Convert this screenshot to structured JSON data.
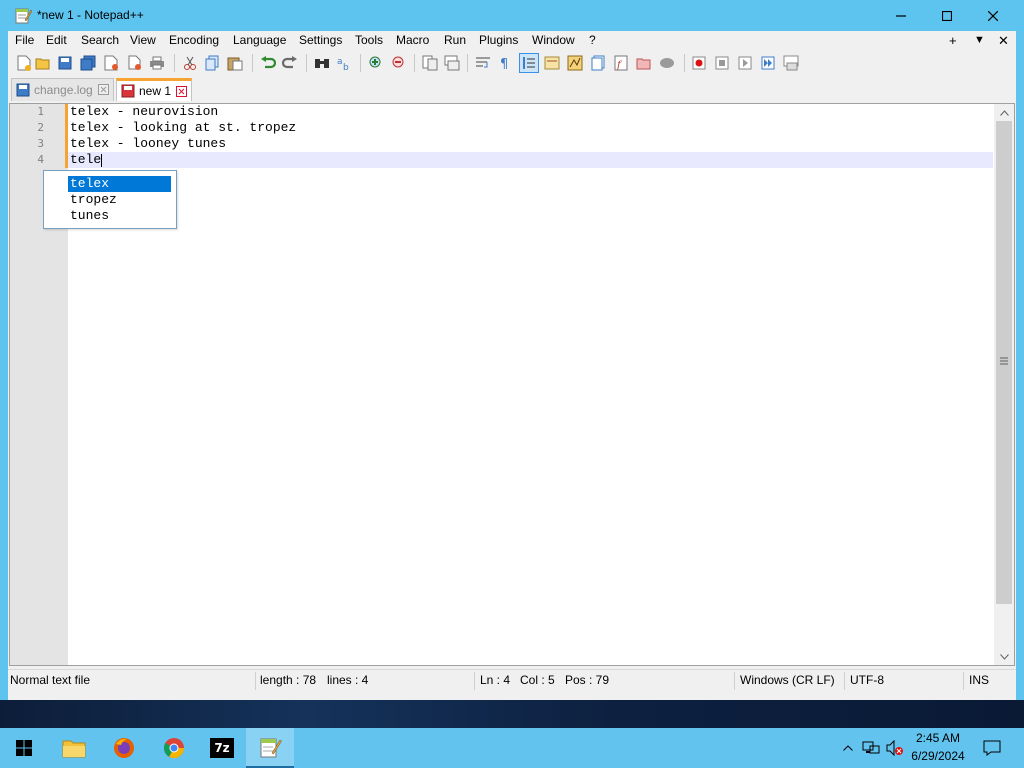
{
  "window": {
    "title": "*new 1 - Notepad++",
    "minimize_symbol": "—",
    "maximize_symbol": "☐",
    "close_symbol": "✕"
  },
  "menubar": {
    "items": [
      "File",
      "Edit",
      "Search",
      "View",
      "Encoding",
      "Language",
      "Settings",
      "Tools",
      "Macro",
      "Run",
      "Plugins",
      "Window",
      "?"
    ],
    "right_plus": "+",
    "right_dropdown": "▼",
    "right_close": "✕"
  },
  "toolbar": {
    "buttons": [
      "new-file-icon",
      "open-file-icon",
      "save-icon",
      "save-all-icon",
      "close-icon",
      "close-all-icon",
      "print-icon",
      "cut-icon",
      "copy-icon",
      "paste-icon",
      "undo-icon",
      "redo-icon",
      "find-icon",
      "replace-icon",
      "zoom-in-icon",
      "zoom-out-icon",
      "sync-vertical-icon",
      "sync-horizontal-icon",
      "word-wrap-icon",
      "show-all-chars-icon",
      "indent-guide-icon",
      "udl-icon",
      "document-map-icon",
      "document-list-icon",
      "function-list-icon",
      "folder-as-workspace-icon",
      "monitoring-icon",
      "record-macro-icon",
      "stop-record-icon",
      "play-macro-icon",
      "run-macro-multiple-icon",
      "save-macro-icon"
    ]
  },
  "tabs": [
    {
      "label": "change.log",
      "active": false
    },
    {
      "label": "new 1",
      "active": true
    }
  ],
  "editor": {
    "line_numbers": [
      "1",
      "2",
      "3",
      "4"
    ],
    "lines": [
      "telex - neurovision",
      "telex - looking at st. tropez",
      "telex - looney tunes",
      "tele"
    ],
    "autocomplete": {
      "items": [
        "telex",
        "tropez",
        "tunes"
      ],
      "selected_index": 0
    }
  },
  "statusbar": {
    "file_type": "Normal text file",
    "length": "length : 78",
    "lines": "lines : 4",
    "ln": "Ln : 4",
    "col": "Col : 5",
    "pos": "Pos : 79",
    "eol": "Windows (CR LF)",
    "encoding": "UTF-8",
    "mode": "INS"
  },
  "taskbar": {
    "apps": [
      "start-icon",
      "file-explorer-icon",
      "firefox-icon",
      "chrome-icon",
      "7zip-icon",
      "notepadpp-icon"
    ],
    "sevenzip_label": "7z",
    "clock_time": "2:45 AM",
    "clock_date": "6/29/2024"
  },
  "colors": {
    "titlebar": "#5cc4ef",
    "accent_tab": "#f7a331",
    "selection": "#0078d7",
    "current_line": "#e8e8ff"
  }
}
